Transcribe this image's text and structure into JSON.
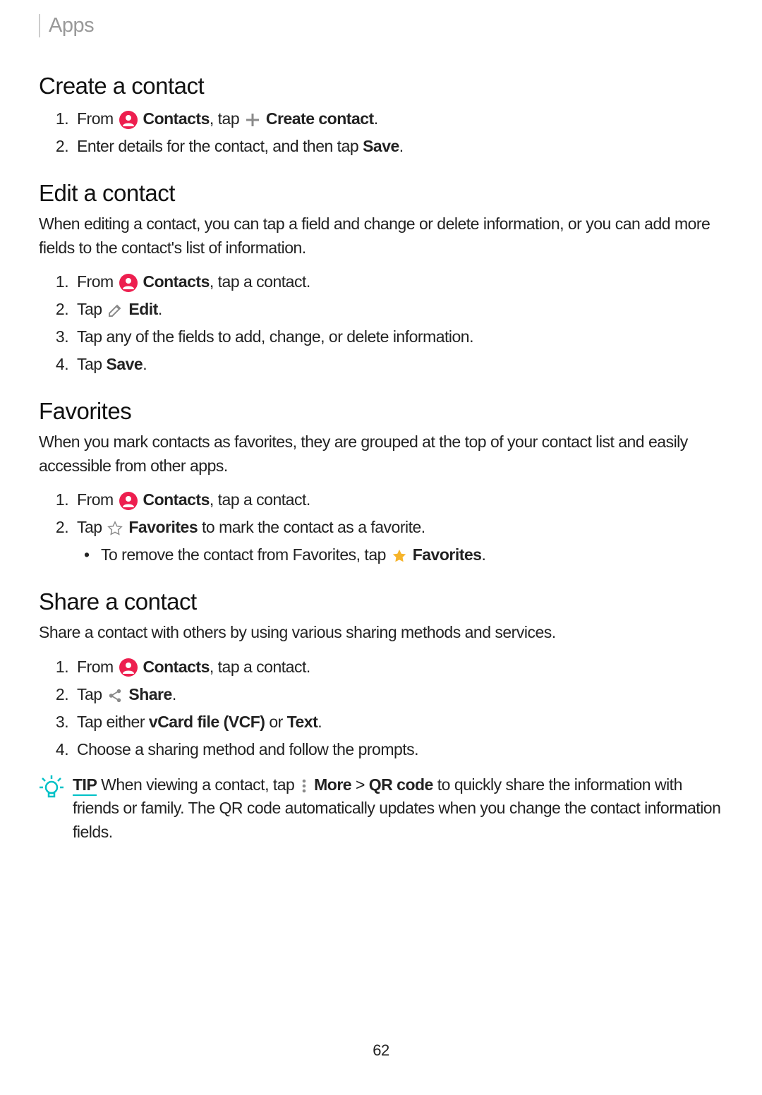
{
  "breadcrumb": "Apps",
  "create": {
    "heading": "Create a contact",
    "steps": [
      {
        "prefix": "From ",
        "contacts": "Contacts",
        "mid": ", tap ",
        "label": "Create contact",
        "suffix": "."
      },
      {
        "text_a": "Enter details for the contact, and then tap ",
        "bold": "Save",
        "text_b": "."
      }
    ]
  },
  "edit": {
    "heading": "Edit a contact",
    "desc": "When editing a contact, you can tap a field and change or delete information, or you can add more fields to the contact's list of information.",
    "steps": [
      {
        "prefix": "From ",
        "contacts": "Contacts",
        "suffix": ", tap a contact."
      },
      {
        "prefix": "Tap ",
        "label": "Edit",
        "suffix": "."
      },
      {
        "text": "Tap any of the fields to add, change, or delete information."
      },
      {
        "prefix": "Tap ",
        "bold": "Save",
        "suffix": "."
      }
    ]
  },
  "favorites": {
    "heading": "Favorites",
    "desc": "When you mark contacts as favorites, they are grouped at the top of your contact list and easily accessible from other apps.",
    "steps": [
      {
        "prefix": "From ",
        "contacts": "Contacts",
        "suffix": ", tap a contact."
      },
      {
        "prefix": "Tap ",
        "label": "Favorites",
        "suffix": " to mark the contact as a favorite."
      }
    ],
    "sub": {
      "prefix": "To remove the contact from Favorites, tap ",
      "label": "Favorites",
      "suffix": "."
    }
  },
  "share": {
    "heading": "Share a contact",
    "desc": "Share a contact with others by using various sharing methods and services.",
    "steps": [
      {
        "prefix": "From ",
        "contacts": "Contacts",
        "suffix": ", tap a contact."
      },
      {
        "prefix": "Tap ",
        "label": "Share",
        "suffix": "."
      },
      {
        "prefix": "Tap either ",
        "bold1": "vCard file (VCF)",
        "mid": " or ",
        "bold2": "Text",
        "suffix": "."
      },
      {
        "text": "Choose a sharing method and follow the prompts."
      }
    ]
  },
  "tip": {
    "label": "TIP",
    "pre": "  When viewing a contact, tap ",
    "more": "More",
    "gt": " > ",
    "qr": "QR code",
    "post": " to quickly share the information with friends or family. The QR code automatically updates when you change the contact information fields."
  },
  "page_num": "62"
}
